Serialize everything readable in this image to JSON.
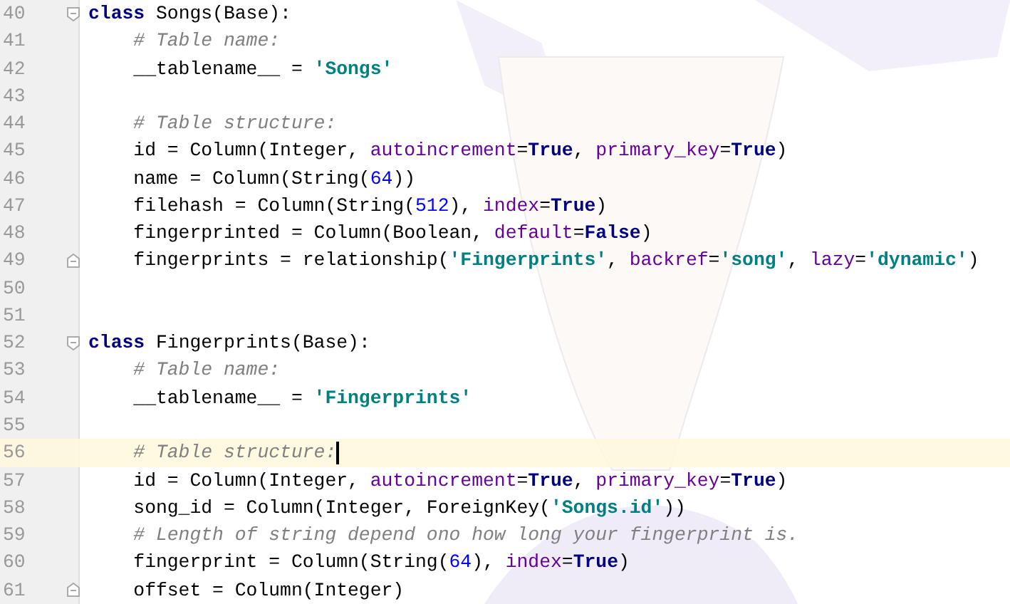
{
  "editor": {
    "lines": [
      {
        "number": "40",
        "fold_start": true,
        "fold_end": false,
        "current": false,
        "tokens": [
          {
            "text": "class",
            "kind": "keyword"
          },
          {
            "text": " Songs(Base):",
            "kind": "plain"
          }
        ]
      },
      {
        "number": "41",
        "fold_start": false,
        "fold_end": false,
        "current": false,
        "tokens": [
          {
            "text": "    # Table name:",
            "kind": "comment"
          }
        ]
      },
      {
        "number": "42",
        "fold_start": false,
        "fold_end": false,
        "current": false,
        "tokens": [
          {
            "text": "    __tablename__ = ",
            "kind": "plain"
          },
          {
            "text": "'Songs'",
            "kind": "string"
          }
        ]
      },
      {
        "number": "43",
        "fold_start": false,
        "fold_end": false,
        "current": false
      },
      {
        "number": "44",
        "fold_start": false,
        "fold_end": false,
        "current": false,
        "tokens": [
          {
            "text": "    # Table structure:",
            "kind": "comment"
          }
        ]
      },
      {
        "number": "45",
        "fold_start": false,
        "fold_end": false,
        "current": false,
        "tokens": [
          {
            "text": "    id = Column(Integer, ",
            "kind": "plain"
          },
          {
            "text": "autoincrement",
            "kind": "argument"
          },
          {
            "text": "=",
            "kind": "plain"
          },
          {
            "text": "True",
            "kind": "keyword"
          },
          {
            "text": ", ",
            "kind": "plain"
          },
          {
            "text": "primary_key",
            "kind": "argument"
          },
          {
            "text": "=",
            "kind": "plain"
          },
          {
            "text": "True",
            "kind": "keyword"
          },
          {
            "text": ")",
            "kind": "plain"
          }
        ]
      },
      {
        "number": "46",
        "fold_start": false,
        "fold_end": false,
        "current": false,
        "tokens": [
          {
            "text": "    name = Column(String(",
            "kind": "plain"
          },
          {
            "text": "64",
            "kind": "number"
          },
          {
            "text": "))",
            "kind": "plain"
          }
        ]
      },
      {
        "number": "47",
        "fold_start": false,
        "fold_end": false,
        "current": false,
        "tokens": [
          {
            "text": "    filehash = Column(String(",
            "kind": "plain"
          },
          {
            "text": "512",
            "kind": "number"
          },
          {
            "text": "), ",
            "kind": "plain"
          },
          {
            "text": "index",
            "kind": "argument"
          },
          {
            "text": "=",
            "kind": "plain"
          },
          {
            "text": "True",
            "kind": "keyword"
          },
          {
            "text": ")",
            "kind": "plain"
          }
        ]
      },
      {
        "number": "48",
        "fold_start": false,
        "fold_end": false,
        "current": false,
        "tokens": [
          {
            "text": "    fingerprinted = Column(Boolean, ",
            "kind": "plain"
          },
          {
            "text": "default",
            "kind": "argument"
          },
          {
            "text": "=",
            "kind": "plain"
          },
          {
            "text": "False",
            "kind": "keyword"
          },
          {
            "text": ")",
            "kind": "plain"
          }
        ]
      },
      {
        "number": "49",
        "fold_start": false,
        "fold_end": true,
        "current": false,
        "tokens": [
          {
            "text": "    fingerprints = relationship(",
            "kind": "plain"
          },
          {
            "text": "'Fingerprints'",
            "kind": "string"
          },
          {
            "text": ", ",
            "kind": "plain"
          },
          {
            "text": "backref",
            "kind": "argument"
          },
          {
            "text": "=",
            "kind": "plain"
          },
          {
            "text": "'song'",
            "kind": "string"
          },
          {
            "text": ", ",
            "kind": "plain"
          },
          {
            "text": "lazy",
            "kind": "argument"
          },
          {
            "text": "=",
            "kind": "plain"
          },
          {
            "text": "'dynamic'",
            "kind": "string"
          },
          {
            "text": ")",
            "kind": "plain"
          }
        ]
      },
      {
        "number": "50",
        "fold_start": false,
        "fold_end": false,
        "current": false
      },
      {
        "number": "51",
        "fold_start": false,
        "fold_end": false,
        "current": false
      },
      {
        "number": "52",
        "fold_start": true,
        "fold_end": false,
        "current": false,
        "tokens": [
          {
            "text": "class",
            "kind": "keyword"
          },
          {
            "text": " Fingerprints(Base):",
            "kind": "plain"
          }
        ]
      },
      {
        "number": "53",
        "fold_start": false,
        "fold_end": false,
        "current": false,
        "tokens": [
          {
            "text": "    # Table name:",
            "kind": "comment"
          }
        ]
      },
      {
        "number": "54",
        "fold_start": false,
        "fold_end": false,
        "current": false,
        "tokens": [
          {
            "text": "    __tablename__ = ",
            "kind": "plain"
          },
          {
            "text": "'Fingerprints'",
            "kind": "string"
          }
        ]
      },
      {
        "number": "55",
        "fold_start": false,
        "fold_end": false,
        "current": false
      },
      {
        "number": "56",
        "fold_start": false,
        "fold_end": false,
        "current": true,
        "tokens": [
          {
            "text": "    # Table structure:",
            "kind": "comment"
          }
        ]
      },
      {
        "number": "57",
        "fold_start": false,
        "fold_end": false,
        "current": false,
        "tokens": [
          {
            "text": "    id = Column(Integer, ",
            "kind": "plain"
          },
          {
            "text": "autoincrement",
            "kind": "argument"
          },
          {
            "text": "=",
            "kind": "plain"
          },
          {
            "text": "True",
            "kind": "keyword"
          },
          {
            "text": ", ",
            "kind": "plain"
          },
          {
            "text": "primary_key",
            "kind": "argument"
          },
          {
            "text": "=",
            "kind": "plain"
          },
          {
            "text": "True",
            "kind": "keyword"
          },
          {
            "text": ")",
            "kind": "plain"
          }
        ]
      },
      {
        "number": "58",
        "fold_start": false,
        "fold_end": false,
        "current": false,
        "tokens": [
          {
            "text": "    song_id = Column(Integer, ForeignKey(",
            "kind": "plain"
          },
          {
            "text": "'Songs.id'",
            "kind": "string"
          },
          {
            "text": "))",
            "kind": "plain"
          }
        ]
      },
      {
        "number": "59",
        "fold_start": false,
        "fold_end": false,
        "current": false,
        "tokens": [
          {
            "text": "    # Length of string depend ono how long your fingerprint is.",
            "kind": "comment"
          }
        ]
      },
      {
        "number": "60",
        "fold_start": false,
        "fold_end": false,
        "current": false,
        "tokens": [
          {
            "text": "    fingerprint = Column(String(",
            "kind": "plain"
          },
          {
            "text": "64",
            "kind": "number"
          },
          {
            "text": "), ",
            "kind": "plain"
          },
          {
            "text": "index",
            "kind": "argument"
          },
          {
            "text": "=",
            "kind": "plain"
          },
          {
            "text": "True",
            "kind": "keyword"
          },
          {
            "text": ")",
            "kind": "plain"
          }
        ]
      },
      {
        "number": "61",
        "fold_start": false,
        "fold_end": true,
        "current": false,
        "tokens": [
          {
            "text": "    offset = Column(Integer)",
            "kind": "plain"
          }
        ]
      }
    ]
  }
}
